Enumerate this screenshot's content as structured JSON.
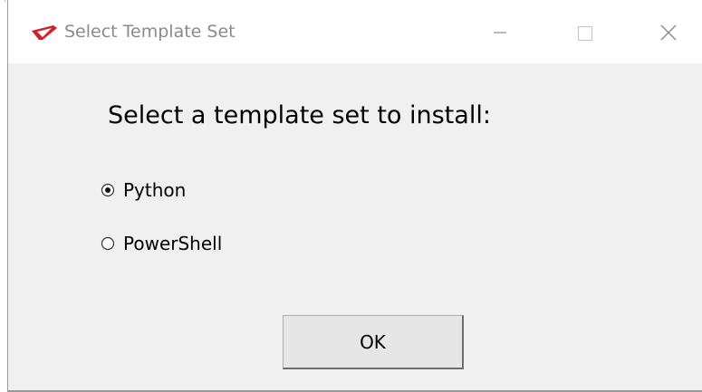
{
  "window": {
    "title": "Select Template Set",
    "icon": "app-logo-icon",
    "controls": {
      "minimize_icon": "minimize-icon",
      "maximize_icon": "maximize-icon",
      "close_icon": "close-icon"
    }
  },
  "dialog": {
    "heading": "Select a template set to install:",
    "options": [
      {
        "label": "Python",
        "selected": true
      },
      {
        "label": "PowerShell",
        "selected": false
      }
    ],
    "ok_label": "OK"
  },
  "colors": {
    "accent": "#d21f2b",
    "background": "#f0f0f0",
    "titlebar": "#ffffff",
    "title_text": "#8a8a8a"
  }
}
